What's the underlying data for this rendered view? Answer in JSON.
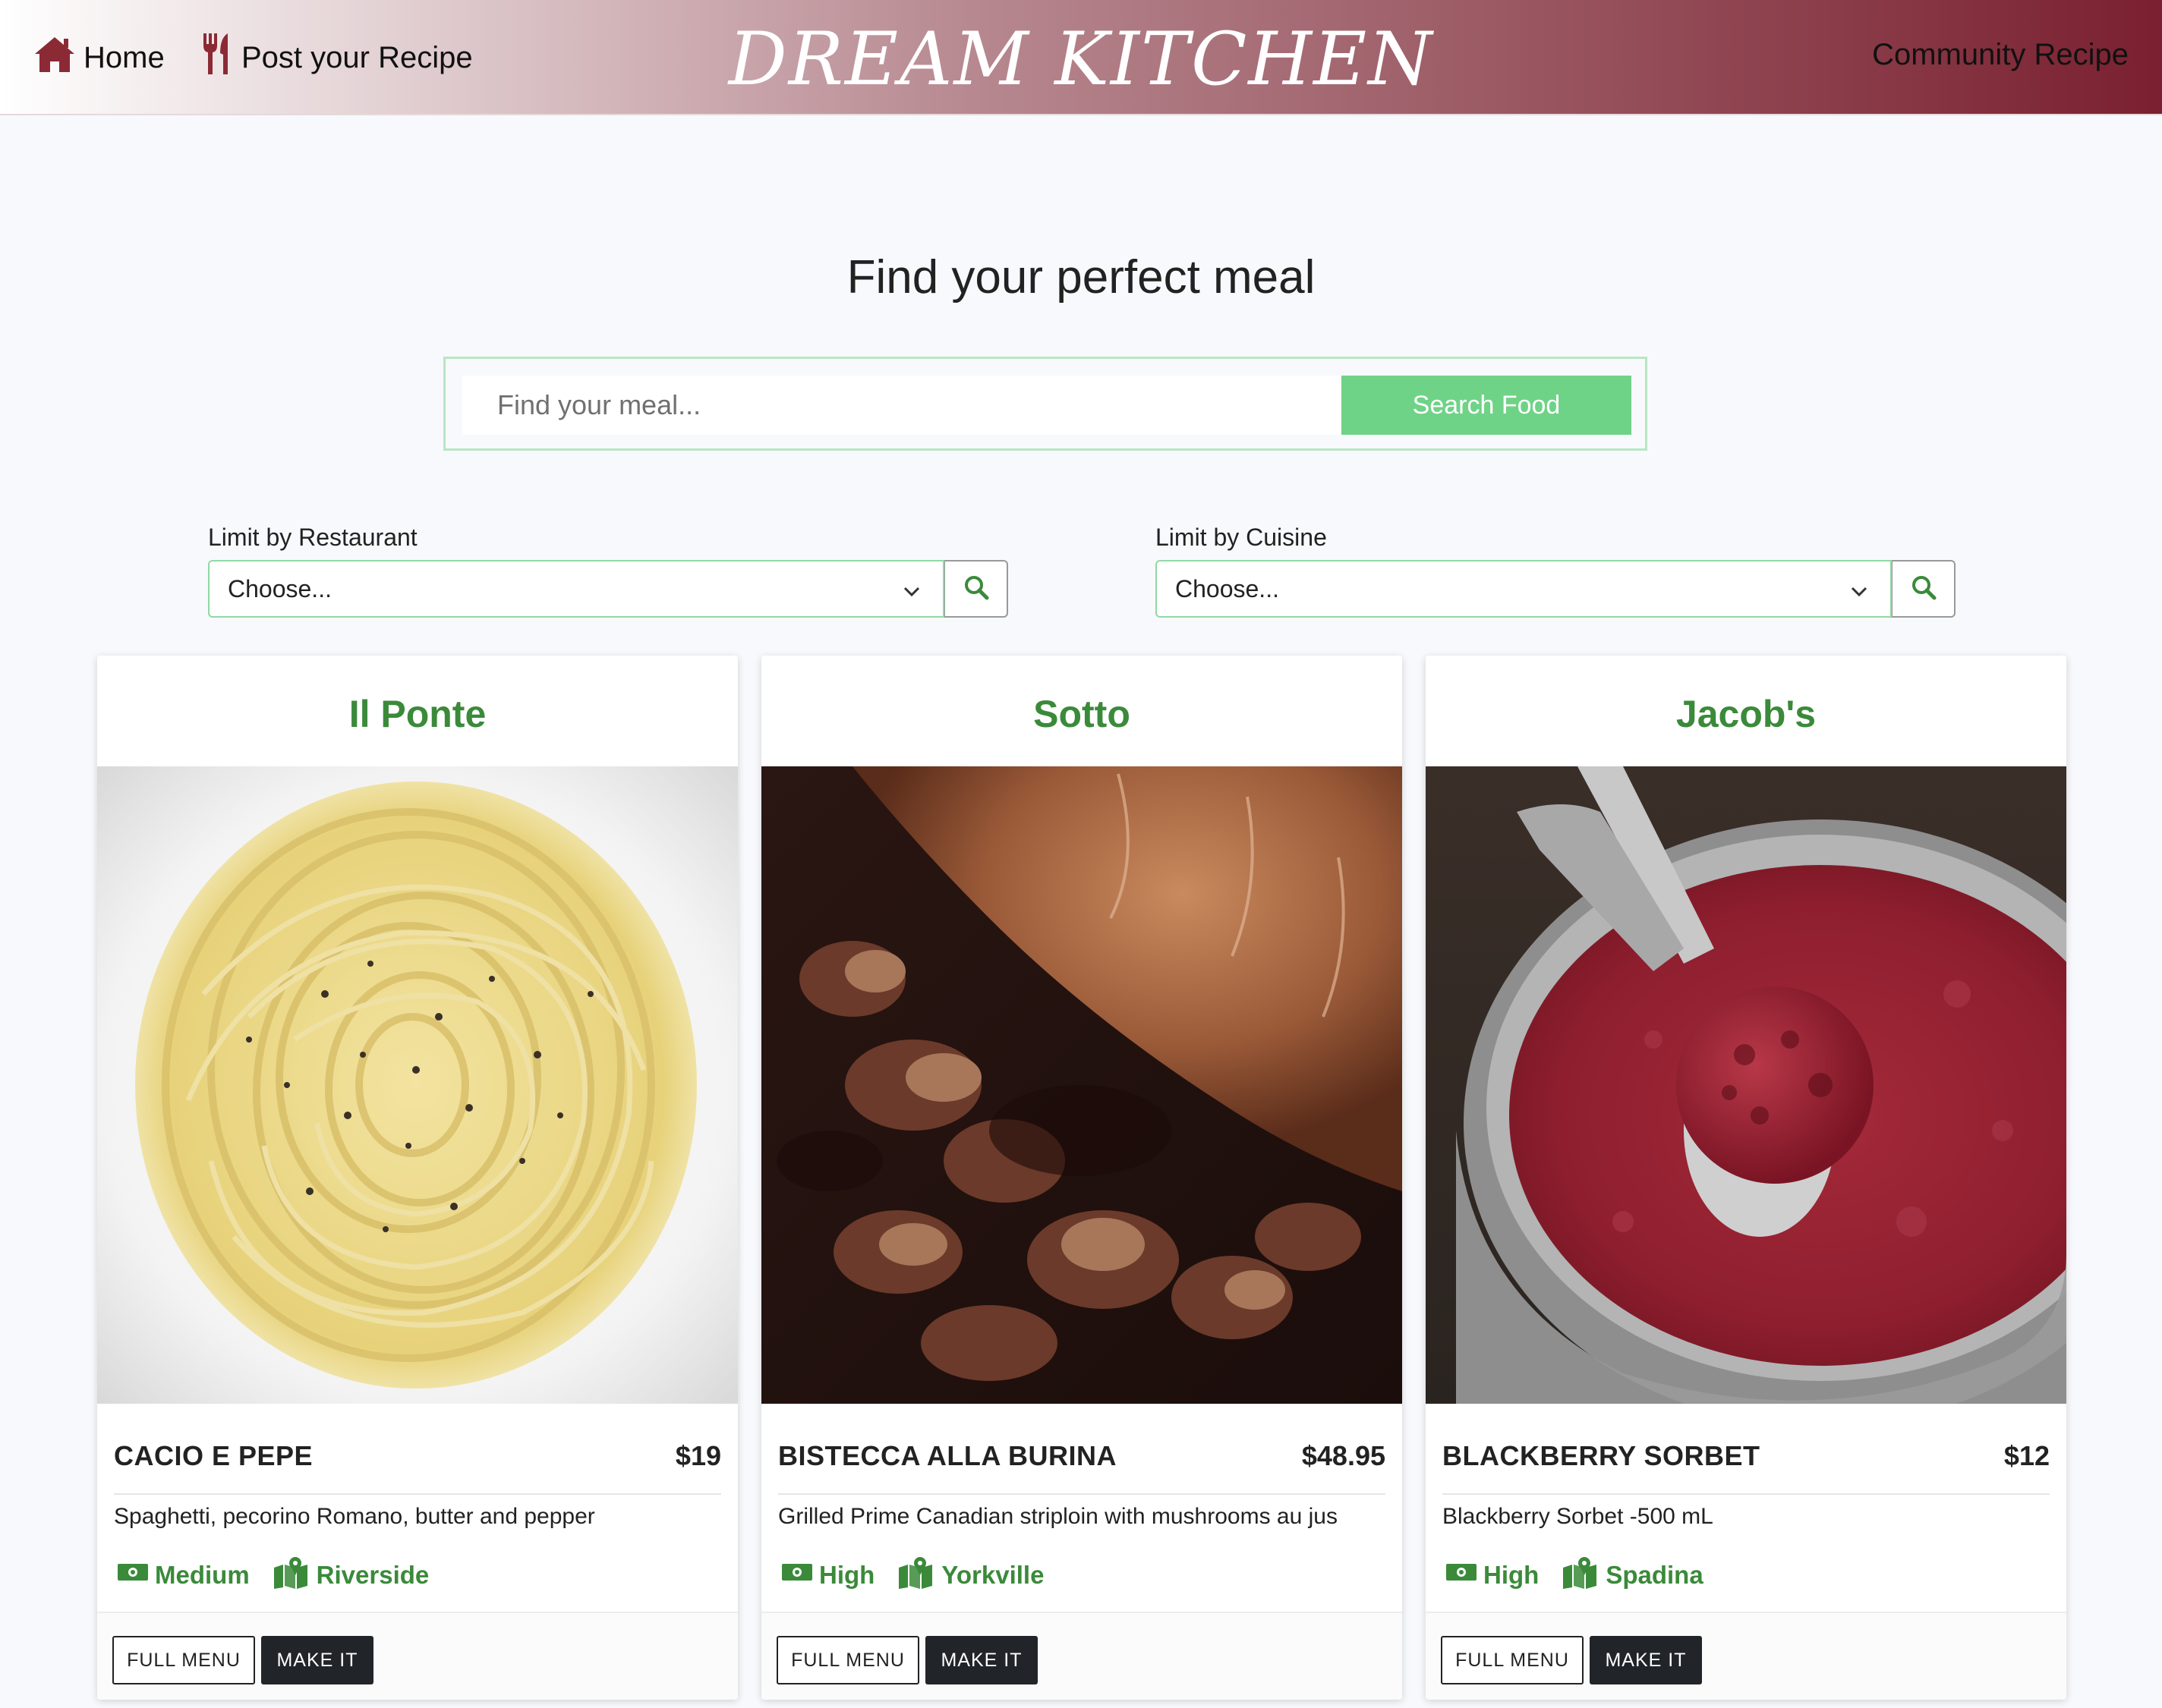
{
  "nav": {
    "home_label": "Home",
    "post_label": "Post your Recipe",
    "brand": "DREAM KITCHEN",
    "community_label": "Community Recipe",
    "icon_color": "#8b2a35"
  },
  "hero": {
    "title": "Find your perfect meal",
    "search_placeholder": "Find your meal...",
    "search_button": "Search Food"
  },
  "filters": {
    "restaurant": {
      "label": "Limit by Restaurant",
      "selected": "Choose..."
    },
    "cuisine": {
      "label": "Limit by Cuisine",
      "selected": "Choose..."
    }
  },
  "cards": [
    {
      "restaurant": "Il Ponte",
      "image": "cacio-e-pepe-photo",
      "dish": "CACIO E PEPE",
      "price": "$19",
      "description": "Spaghetti, pecorino Romano, butter and pepper",
      "price_level": "Medium",
      "location": "Riverside",
      "full_menu": "FULL MENU",
      "make_it": "MAKE IT"
    },
    {
      "restaurant": "Sotto",
      "image": "bistecca-photo",
      "dish": "BISTECCA ALLA BURINA",
      "price": "$48.95",
      "description": "Grilled Prime Canadian striploin with mushrooms au jus",
      "price_level": "High",
      "location": "Yorkville",
      "full_menu": "FULL MENU",
      "make_it": "MAKE IT"
    },
    {
      "restaurant": "Jacob's",
      "image": "blackberry-sorbet-photo",
      "dish": "BLACKBERRY SORBET",
      "price": "$12",
      "description": "Blackberry Sorbet -500 mL",
      "price_level": "High",
      "location": "Spadina",
      "full_menu": "FULL MENU",
      "make_it": "MAKE IT"
    }
  ],
  "colors": {
    "accent_green": "#3a8a3a",
    "search_button": "#6fd387",
    "dark_button": "#212529"
  }
}
